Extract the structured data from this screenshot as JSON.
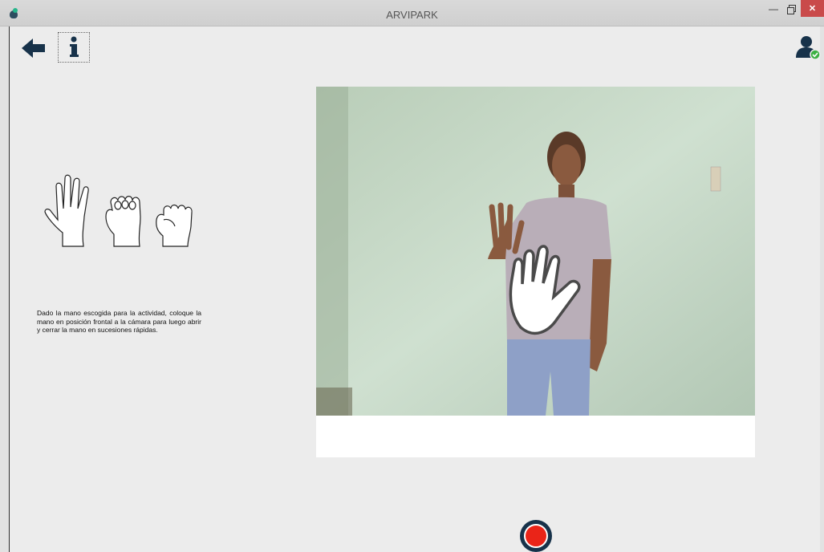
{
  "window": {
    "title": "ARVIPARK",
    "minimize_symbol": "—",
    "close_symbol": "✕"
  },
  "toolbar": {
    "back_icon": "arrow-left-icon",
    "info_label": "i",
    "user_icon": "user-check-icon"
  },
  "instructions": {
    "text": "Dado la mano escogida para la actividad, coloque la mano en posición frontal a la cámara para luego abrir y cerrar la mano en sucesiones rápidas."
  },
  "camera": {
    "overlay_icon": "open-hand-icon",
    "caption": ""
  },
  "controls": {
    "record_icon": "record-icon"
  },
  "colors": {
    "accent": "#17324a",
    "record": "#ea2418",
    "user_status": "#3cb043"
  }
}
